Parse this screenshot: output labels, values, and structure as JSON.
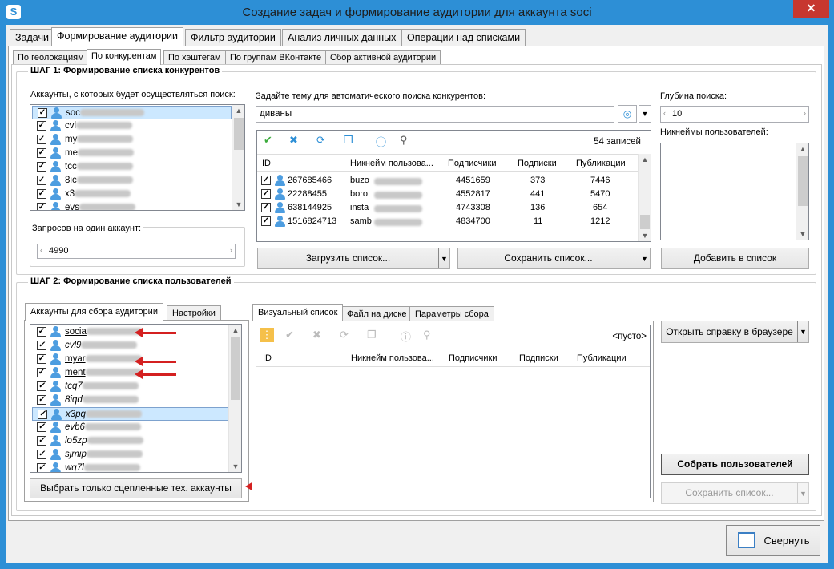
{
  "window": {
    "title": "Создание задач и формирование аудитории для аккаунта soci",
    "close": "✕"
  },
  "main_tabs": [
    "Задачи",
    "Формирование аудитории",
    "Фильтр аудитории",
    "Анализ личных данных",
    "Операции над списками"
  ],
  "sub_tabs": [
    "По геолокациям",
    "По конкурентам",
    "По хэштегам",
    "По группам ВКонтакте",
    "Сбор активной аудитории"
  ],
  "step1": {
    "title": "ШАГ 1: Формирование списка конкурентов",
    "accounts_label": "Аккаунты, с которых будет осуществляться поиск:",
    "accounts": [
      "soc",
      "cvl",
      "my",
      "me",
      "tcc",
      "8ic",
      "x3",
      "evs"
    ],
    "requests_label": "Запросов на один аккаунт:",
    "requests_value": "4990",
    "topic_label": "Задайте тему для автоматического поиска конкурентов:",
    "topic_value": "диваны",
    "records_count": "54 записей",
    "columns": [
      "ID",
      "Никнейм пользова...",
      "Подписчики",
      "Подписки",
      "Публикации"
    ],
    "rows": [
      {
        "id": "267685466",
        "nick": "buzo",
        "followers": "4451659",
        "following": "373",
        "posts": "7446"
      },
      {
        "id": "22288455",
        "nick": "boro",
        "followers": "4552817",
        "following": "441",
        "posts": "5470"
      },
      {
        "id": "638144925",
        "nick": "insta",
        "followers": "4743308",
        "following": "136",
        "posts": "654"
      },
      {
        "id": "1516824713",
        "nick": "samb",
        "followers": "4834700",
        "following": "11",
        "posts": "1212"
      }
    ],
    "load_button": "Загрузить список...",
    "save_button": "Сохранить список...",
    "depth_label": "Глубина поиска:",
    "depth_value": "10",
    "nicknames_label": "Никнеймы пользователей:",
    "add_button": "Добавить в список"
  },
  "step2": {
    "title": "ШАГ 2: Формирование списка пользователей",
    "left_tabs": [
      "Аккаунты для сбора аудитории",
      "Настройки"
    ],
    "accounts": [
      "socia",
      "cvl9",
      "myar",
      "ment",
      "tcq7",
      "8iqd",
      "x3pq",
      "evb6",
      "lo5zp",
      "sjmip",
      "wq7l"
    ],
    "select_linked_button": "Выбрать только сцепленные тех. аккаунты",
    "right_tabs": [
      "Визуальный список",
      "Файл на диске",
      "Параметры сбора"
    ],
    "empty_label": "<пусто>",
    "columns": [
      "ID",
      "Никнейм пользова...",
      "Подписчики",
      "Подписки",
      "Публикации"
    ],
    "open_help_button": "Открыть справку в браузере",
    "collect_button": "Собрать пользователей",
    "save_button": "Сохранить список..."
  },
  "footer": {
    "minimize_button": "Свернуть"
  }
}
